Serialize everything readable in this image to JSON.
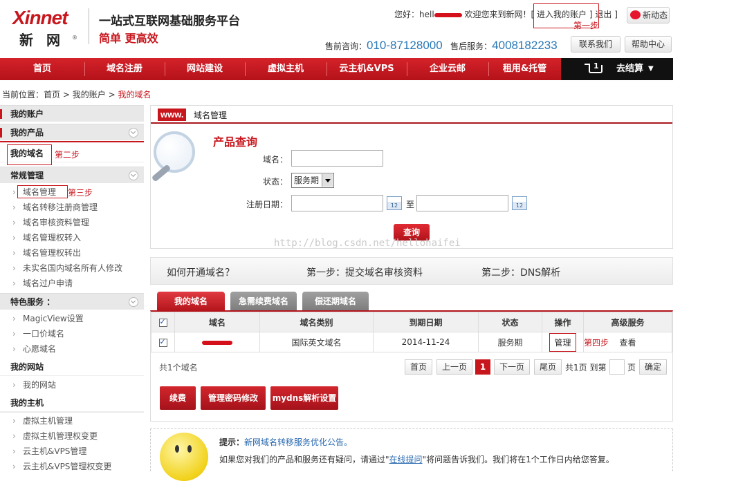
{
  "header": {
    "logo_en": "Xinnet",
    "logo_cn": "新 网",
    "logo_reg": "®",
    "slogan_main": "一站式互联网基础服务平台",
    "slogan_sub": "简单 更高效",
    "greeting_prefix": "您好：hell",
    "greeting_suffix": "欢迎您来到新网！[",
    "enter_account": "进入我的账户",
    "separator": "]",
    "logout": "退出",
    "close_bracket": "]",
    "weibo_label": "新动态",
    "presale_label": "售前咨询：",
    "presale_phone": "010-87128000",
    "aftersale_label": "售后服务：",
    "aftersale_phone": "4008182233",
    "contact_btn": "联系我们",
    "help_btn": "帮助中心"
  },
  "nav": {
    "items": [
      "首页",
      "域名注册",
      "网站建设",
      "虚拟主机",
      "云主机&VPS",
      "企业云邮",
      "租用&托管"
    ],
    "cart": "去结算",
    "cart_count": "1"
  },
  "breadcrumb": {
    "prefix": "当前位置：",
    "home": "首页",
    "arrow": ">",
    "account": "我的账户",
    "current": "我的域名"
  },
  "sidebar": {
    "my_account": "我的账户",
    "my_products": "我的产品",
    "my_domains": "我的域名",
    "general_mgmt": "常规管理",
    "general_items": [
      "域名管理",
      "域名转移注册商管理",
      "域名审核资料管理",
      "域名管理权转入",
      "域名管理权转出",
      "未实名国内域名所有人修改",
      "域名过户申请"
    ],
    "special_services": "特色服务 ：",
    "special_items": [
      "MagicView设置",
      "一口价域名",
      "心愿域名"
    ],
    "my_website": "我的网站",
    "website_items": [
      "我的网站"
    ],
    "my_host": "我的主机",
    "host_items": [
      "虚拟主机管理",
      "虚拟主机管理权变更",
      "云主机&VPS管理",
      "云主机&VPS管理权变更"
    ]
  },
  "steps": {
    "step1": "第一步",
    "step2": "第二步",
    "step3": "第三步",
    "step4": "第四步"
  },
  "query": {
    "badge": "www.",
    "panel_title": "域名管理",
    "title": "产品查询",
    "domain_label": "域名：",
    "status_label": "状态：",
    "status_value": "服务期",
    "reg_date_label": "注册日期：",
    "to": "至",
    "cal_label": "12",
    "submit": "查询"
  },
  "watermark": "http://blog.csdn.net/hellohaifei",
  "howto": {
    "question": "如何开通域名？",
    "step1": "第一步：提交域名审核资料",
    "step2": "第二步：DNS解析"
  },
  "tabs": [
    "我的域名",
    "急需续费域名",
    "偿还期域名"
  ],
  "table": {
    "headers": [
      "域名",
      "域名类别",
      "到期日期",
      "状态",
      "操作",
      "高级服务"
    ],
    "rows": [
      {
        "type": "国际英文域名",
        "expiry": "2014-11-24",
        "status": "服务期",
        "action": "管理",
        "advanced": "查看"
      }
    ]
  },
  "pagination": {
    "total": "共1个域名",
    "first": "首页",
    "prev": "上一页",
    "current": "1",
    "next": "下一页",
    "last": "尾页",
    "pages_info": "共1页 到第",
    "page_suffix": "页",
    "confirm": "确定"
  },
  "actions": [
    "续费",
    "管理密码修改",
    "mydns解析设置"
  ],
  "tips": {
    "label": "提示：",
    "notice": "新网域名转移服务优化公告。",
    "line2_prefix": "如果您对我们的产品和服务还有疑问，请通过\"",
    "online_link": "在线提问",
    "line2_suffix": "\"将问题告诉我们。我们将在1个工作日内给您答复。"
  },
  "colors": {
    "brand_red": "#c8161d",
    "phone_blue": "#2a79b8",
    "nav_dark": "#111111"
  }
}
